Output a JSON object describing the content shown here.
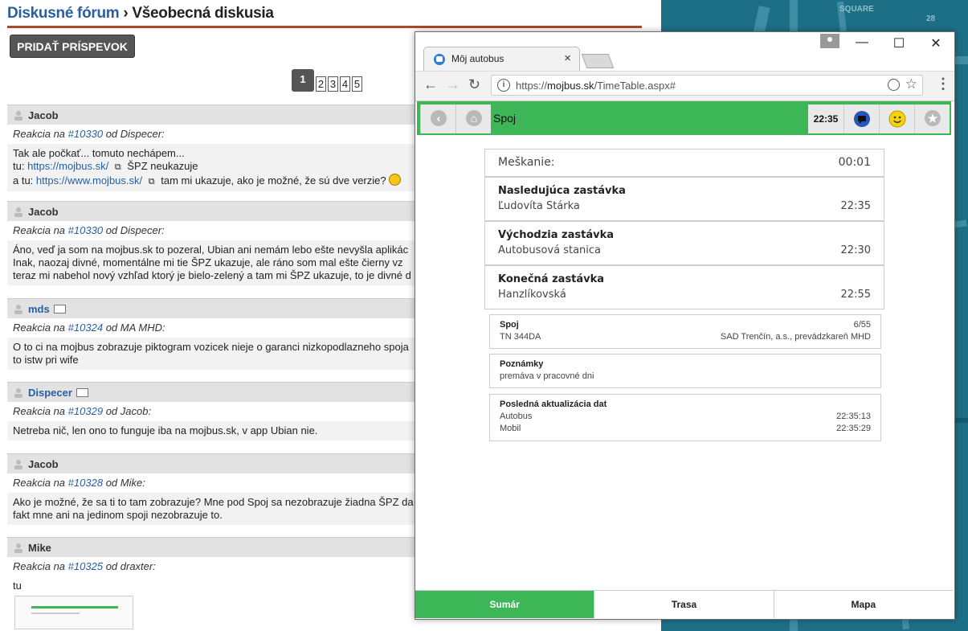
{
  "forum": {
    "breadcrumb_link": "Diskusné fórum",
    "breadcrumb_sep": "›",
    "breadcrumb_current": "Všeobecná diskusia",
    "add_post_button": "PRIDAŤ PRÍSPEVOK",
    "pager": {
      "current": "1",
      "pages": [
        "2",
        "3",
        "4",
        "5"
      ]
    },
    "posts": [
      {
        "author": "Jacob",
        "reply_prefix": "Reakcia na",
        "reply_ref": "#10330",
        "reply_suffix": "od Dispecer:",
        "lines": [
          "Tak ale počkať... tomuto nechápem...",
          "tu:",
          "https://mojbus.sk/",
          "ŠPZ neukazuje",
          "a tu:",
          "https://www.mojbus.sk/",
          "tam mi ukazuje, ako je možné, že sú dve verzie?"
        ]
      },
      {
        "author": "Jacob",
        "reply_prefix": "Reakcia na",
        "reply_ref": "#10330",
        "reply_suffix": "od Dispecer:",
        "lines": [
          "Áno, veď ja som na mojbus.sk to pozeral, Ubian ani nemám lebo ešte nevyšla aplikác",
          "Inak, naozaj divné, momentálne mi tie ŠPZ ukazuje, ale ráno som mal ešte čierny vz",
          "teraz mi nabehol nový vzhľad ktorý je bielo-zelený a tam mi ŠPZ ukazuje, to je divné d"
        ]
      },
      {
        "author": "mds",
        "reply_prefix": "Reakcia na",
        "reply_ref": "#10324",
        "reply_suffix": "od MA MHD:",
        "lines": [
          "O to ci na mojbus zobrazuje piktogram vozicek nieje o garanci nizkopodlazneho spoja",
          "to istw pri wife"
        ]
      },
      {
        "author": "Dispecer",
        "reply_prefix": "Reakcia na",
        "reply_ref": "#10329",
        "reply_suffix": "od Jacob:",
        "lines": [
          "Netreba nič, len ono to funguje iba na mojbus.sk, v app Ubian nie."
        ]
      },
      {
        "author": "Jacob",
        "reply_prefix": "Reakcia na",
        "reply_ref": "#10328",
        "reply_suffix": "od Mike:",
        "lines": [
          "Ako je možné, že sa ti to tam zobrazuje? Mne pod Spoj sa nezobrazuje žiadna ŠPZ da",
          "fakt mne ani na jedinom spoji nezobrazuje to."
        ]
      },
      {
        "author": "Mike",
        "reply_prefix": "Reakcia na",
        "reply_ref": "#10325",
        "reply_suffix": "od draxter:",
        "lines": [
          "tu"
        ]
      }
    ]
  },
  "browser": {
    "tab_title": "Môj autobus",
    "tab_close": "×",
    "url_prefix": "https://",
    "url_host": "mojbus.sk",
    "url_path": "/TimeTable.aspx#",
    "minimize": "—",
    "maximize": "☐",
    "close": "✕",
    "info_glyph": "i",
    "star_glyph": "☆",
    "menu_glyph": "⋮",
    "back_glyph": "←",
    "forward_glyph": "→",
    "reload_glyph": "↻"
  },
  "app": {
    "title": "Spoj",
    "time": "22:35",
    "back_glyph": "‹",
    "home_glyph": "⌂",
    "fav_glyph": "★",
    "delay_label": "Meškanie:",
    "delay_value": "00:01",
    "next_stop_label": "Nasledujúca zastávka",
    "next_stop_name": "Ľudovíta Stárka",
    "next_stop_time": "22:35",
    "origin_label": "Východzia zastávka",
    "origin_name": "Autobusová stanica",
    "origin_time": "22:30",
    "final_label": "Konečná zastávka",
    "final_name": "Hanzlíkovská",
    "final_time": "22:55",
    "spoj_label": "Spoj",
    "spoj_number": "6/55",
    "spoj_line": "TN 344DA",
    "operator": "SAD Trenčín, a.s., prevádzkareň MHD",
    "notes_label": "Poznámky",
    "notes_value": "premáva v pracovné dni",
    "update_label": "Posledná aktualizácia dat",
    "update_bus_label": "Autobus",
    "update_bus_time": "22:35:13",
    "update_mobile_label": "Mobil",
    "update_mobile_time": "22:35:29",
    "tabs": [
      "Sumár",
      "Trasa",
      "Mapa"
    ]
  },
  "map_labels": [
    "SQUARE",
    "28"
  ],
  "colors": {
    "accent_green": "#3db657",
    "link_blue": "#2a5ea3",
    "map_blue": "#1d6f86"
  }
}
